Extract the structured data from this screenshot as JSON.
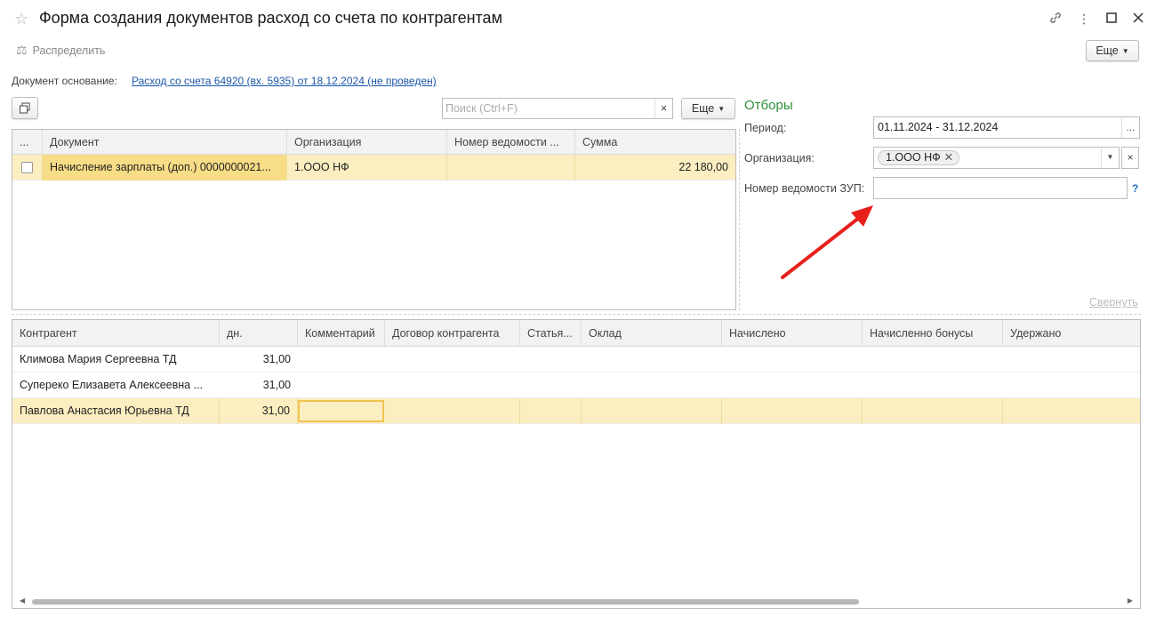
{
  "window": {
    "title": "Форма создания документов расход со счета по контрагентам",
    "icons": [
      "star-icon",
      "link-icon",
      "more-vertical-icon",
      "maximize-icon",
      "close-icon"
    ]
  },
  "toolbar": {
    "distribute_label": "Распределить",
    "more_label": "Еще"
  },
  "doc_basis": {
    "label": "Документ основание:",
    "link": "Расход со счета 64920 (вх. 5935) от 18.12.2024 (не проведен)"
  },
  "top_table": {
    "search_placeholder": "Поиск (Ctrl+F)",
    "search_clear": "×",
    "more_label": "Еще",
    "columns": [
      "...",
      "Документ",
      "Организация",
      "Номер ведомости ...",
      "Сумма"
    ],
    "rows": [
      {
        "document": "Начисление зарплаты (доп.) 0000000021...",
        "organization": "1.ООО НФ",
        "statement_no": "",
        "amount": "22 180,00"
      }
    ]
  },
  "filters": {
    "title": "Отборы",
    "period_label": "Период:",
    "period_value": "01.11.2024 - 31.12.2024",
    "period_button": "...",
    "org_label": "Организация:",
    "org_tag": "1.ООО НФ",
    "zup_label": "Номер ведомости ЗУП:",
    "zup_value": "",
    "help": "?",
    "collapse_label": "Свернуть"
  },
  "bottom_table": {
    "columns": [
      "Контрагент",
      "дн.",
      "Комментарий",
      "Договор контрагента",
      "Статья...",
      "Оклад",
      "Начислено",
      "Начисленно бонусы",
      "Удержано"
    ],
    "rows": [
      {
        "counterparty": "Климова Мария Сергеевна ТД",
        "days": "31,00"
      },
      {
        "counterparty": "Суперeко Елизавета Алексеевна ...",
        "days": "31,00"
      },
      {
        "counterparty": "Павлова Анастасия Юрьевна ТД",
        "days": "31,00"
      }
    ]
  },
  "colors": {
    "selected_row": "#fbeec0",
    "accent_green": "#2d8f3a",
    "link_blue": "#1a56a8",
    "annotation_arrow": "#e8201c"
  }
}
